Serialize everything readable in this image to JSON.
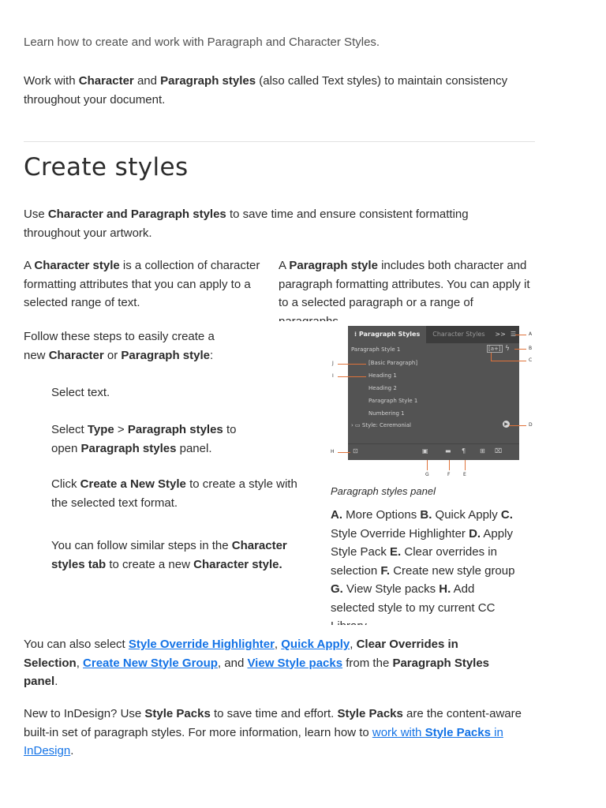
{
  "intro": "Learn how to create and work with Paragraph and Character Styles.",
  "para1": {
    "t1": "Work with ",
    "b1": "Character",
    "t2": " and ",
    "b2": "Paragraph styles",
    "t3": " (also called Text styles) to maintain consistency throughout your document."
  },
  "heading": "Create styles",
  "para2": {
    "t1": "Use ",
    "b1": "Character and Paragraph styles",
    "t2": " to save time and ensure consistent formatting throughout your artwork."
  },
  "col_left": {
    "t1": "A ",
    "b1": "Character style",
    "t2": " is a collection of character formatting attributes that you can apply to a selected range of text."
  },
  "col_right": {
    "t1": "A ",
    "b1": "Paragraph style",
    "t2": " includes both character and paragraph formatting attributes. You can apply it to a selected paragraph or a range of paragraphs."
  },
  "steps_intro": {
    "t1": " Follow these steps to easily create a new ",
    "b1": "Character",
    "t2": " or ",
    "b2": "Paragraph style",
    "t3": ":"
  },
  "step1": "Select text.",
  "step2": {
    "t1": "Select ",
    "b1": "Type",
    "t2": " > ",
    "b2": "Paragraph styles",
    "t3": " to open ",
    "b3": "Paragraph styles",
    "t4": " panel."
  },
  "step3": {
    "t1": "Click ",
    "b1": "Create a New Style",
    "t2": "   to create a style with the selected text format."
  },
  "step4": {
    "t1": "You can follow similar steps in the ",
    "b1": "Character styles tab",
    "t2": " to create a new ",
    "b2": "Character style."
  },
  "panel": {
    "tab_active": "Paragraph Styles",
    "tab_inactive": "Character Styles",
    "menu_arrows": ">>",
    "current_style": "Paragraph Style 1",
    "quick_apply": "[a+]",
    "rows": [
      "[Basic Paragraph]",
      "Heading 1",
      "Heading 2",
      "Paragraph Style 1",
      "Numbering 1"
    ],
    "group_row": "Style: Ceremonial",
    "callouts": [
      "A",
      "B",
      "C",
      "D",
      "E",
      "F",
      "G",
      "H",
      "I",
      "J"
    ]
  },
  "caption": "Paragraph styles panel",
  "legend": {
    "a_key": "A.",
    "a_val": " More Options ",
    "b_key": "B.",
    "b_val": " Quick Apply ",
    "c_key": "C.",
    "c_val": " Style Override Highlighter ",
    "d_key": "D.",
    "d_val": " Apply Style Pack ",
    "e_key": "E.",
    "e_val": " Clear overrides in selection ",
    "f_key": "F.",
    "f_val": " Create new style group ",
    "g_key": "G.",
    "g_val": " View Style packs ",
    "h_key": "H.",
    "h_val": " Add selected style to my current CC Library"
  },
  "para3": {
    "t1": "You can also select ",
    "l1": "Style Override Highlighter",
    "t2": ", ",
    "l2": "Quick Apply",
    "t3": ", ",
    "b1": "Clear Overrides in Selection",
    "t4": ", ",
    "l3": "Create New Style Group",
    "t5": ", and ",
    "l4": "View Style packs",
    "t6": " from the ",
    "b2": "Paragraph Styles panel",
    "t7": "."
  },
  "para4": {
    "t1": "New to InDesign? Use ",
    "b1": "Style Packs",
    "t2": " to save time and effort. ",
    "b2": "Style Packs",
    "t3": " are the content-aware built-in set of paragraph styles. For more information, learn how to ",
    "l1a": "work with ",
    "l1b": "Style Packs",
    "l1c": " in InDesign",
    "t4": "."
  },
  "colors": {
    "link": "#1473e6",
    "callout": "#e0733a",
    "panel_bg": "#535353",
    "panel_tabbar": "#3d3d3d"
  },
  "icons": [
    "grip-icon",
    "more-options-icon",
    "quick-apply-icon",
    "lightning-icon",
    "chevron-right-icon",
    "folder-icon",
    "apply-style-pack-icon",
    "cc-library-icon",
    "style-pack-icon",
    "new-group-icon",
    "clear-overrides-icon",
    "new-style-icon",
    "trash-icon"
  ]
}
